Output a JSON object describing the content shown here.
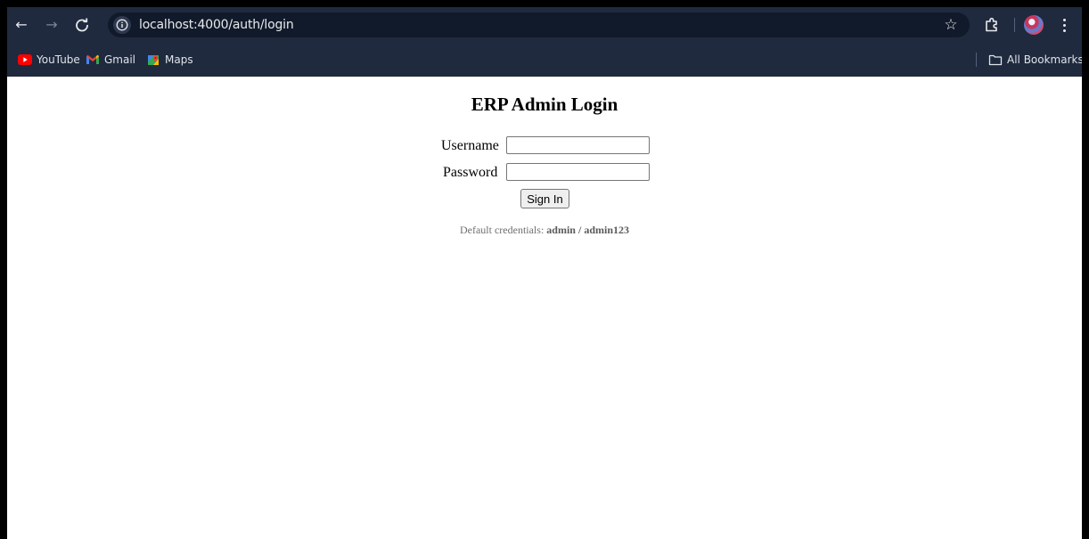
{
  "browser": {
    "url": "localhost:4000/auth/login",
    "bookmarks": [
      {
        "label": "YouTube",
        "icon": "youtube-icon"
      },
      {
        "label": "Gmail",
        "icon": "gmail-icon"
      },
      {
        "label": "Maps",
        "icon": "maps-icon"
      }
    ],
    "all_bookmarks_label": "All Bookmarks",
    "colors": {
      "toolbar_bg": "#1f2a3e",
      "omnibox_bg": "#111a2a"
    }
  },
  "login": {
    "title": "ERP Admin Login",
    "username_label": "Username",
    "username_value": "",
    "password_label": "Password",
    "password_value": "",
    "submit_label": "Sign In",
    "credentials_prefix": "Default credentials: ",
    "credentials_user": "admin",
    "credentials_separator": " / ",
    "credentials_pass": "admin123"
  }
}
